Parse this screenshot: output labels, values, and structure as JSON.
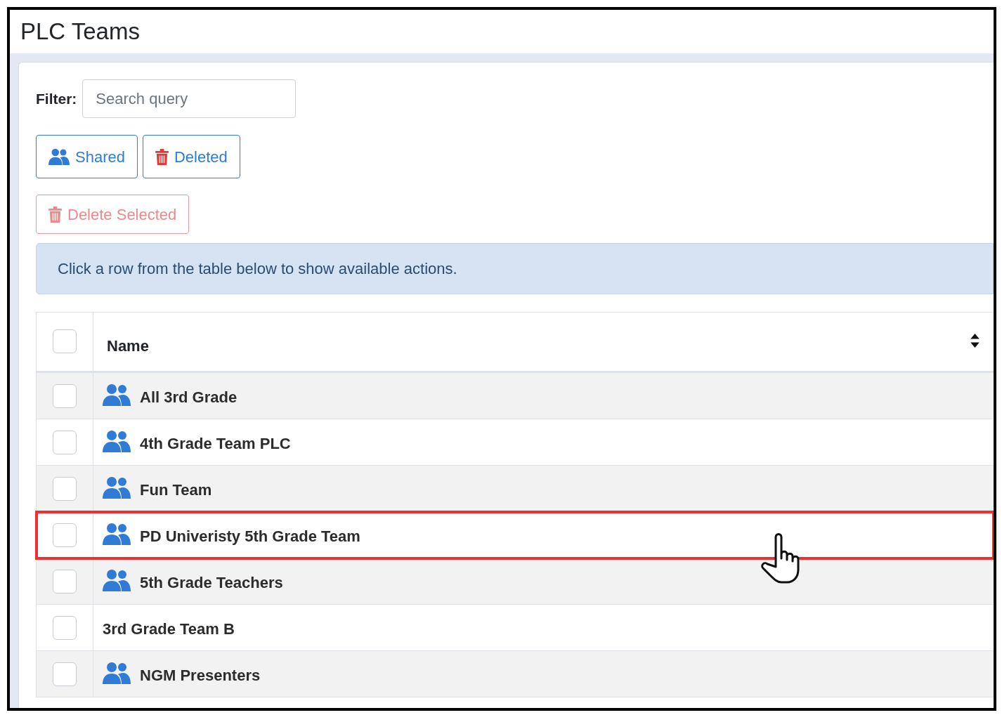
{
  "page_title": "PLC Teams",
  "filter": {
    "label": "Filter:",
    "placeholder": "Search query"
  },
  "buttons": [
    {
      "kind": "shared",
      "label": "Shared"
    },
    {
      "kind": "deleted",
      "label": "Deleted"
    }
  ],
  "delete_selected": {
    "label": "Delete Selected",
    "disabled": true
  },
  "info_alert": "Click a row from the table below to show available actions.",
  "table": {
    "select_all": {
      "checked": false
    },
    "columns": [
      {
        "label": "Name"
      }
    ],
    "rows": [
      {
        "name": "All 3rd Grade",
        "shared": true,
        "checked": false,
        "highlighted": false
      },
      {
        "name": "4th Grade Team PLC",
        "shared": true,
        "checked": false,
        "highlighted": false
      },
      {
        "name": "Fun Team",
        "shared": true,
        "checked": false,
        "highlighted": false
      },
      {
        "name": "PD Univeristy 5th Grade Team",
        "shared": true,
        "checked": false,
        "highlighted": true
      },
      {
        "name": "5th Grade Teachers",
        "shared": true,
        "checked": false,
        "highlighted": false
      },
      {
        "name": "3rd Grade Team B",
        "shared": false,
        "checked": false,
        "highlighted": false
      },
      {
        "name": "NGM Presenters",
        "shared": true,
        "checked": false,
        "highlighted": false
      }
    ]
  }
}
